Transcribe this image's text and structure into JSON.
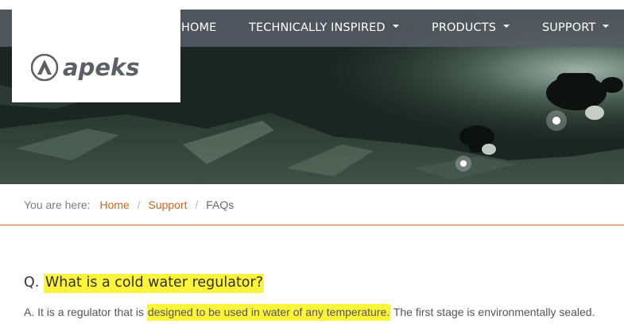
{
  "brand": {
    "logo_text": "apeks"
  },
  "nav": {
    "items": [
      {
        "label": "HOME",
        "has_dropdown": false
      },
      {
        "label": "TECHNICALLY INSPIRED",
        "has_dropdown": true
      },
      {
        "label": "PRODUCTS",
        "has_dropdown": true
      },
      {
        "label": "SUPPORT",
        "has_dropdown": true
      }
    ]
  },
  "breadcrumb": {
    "lead": "You are here:",
    "items": [
      "Home",
      "Support"
    ],
    "current": "FAQs"
  },
  "faq": {
    "question_prefix": "Q.",
    "question": "What is a cold water regulator?",
    "answer_prefix": "A. It is a regulator that is",
    "answer_highlight": "designed to be used in water of any temperature.",
    "answer_suffix": "The first stage is environmentally sealed."
  },
  "colors": {
    "nav_bg": "#555c64",
    "accent_orange": "#d0661b",
    "highlight": "#fbf43a"
  }
}
